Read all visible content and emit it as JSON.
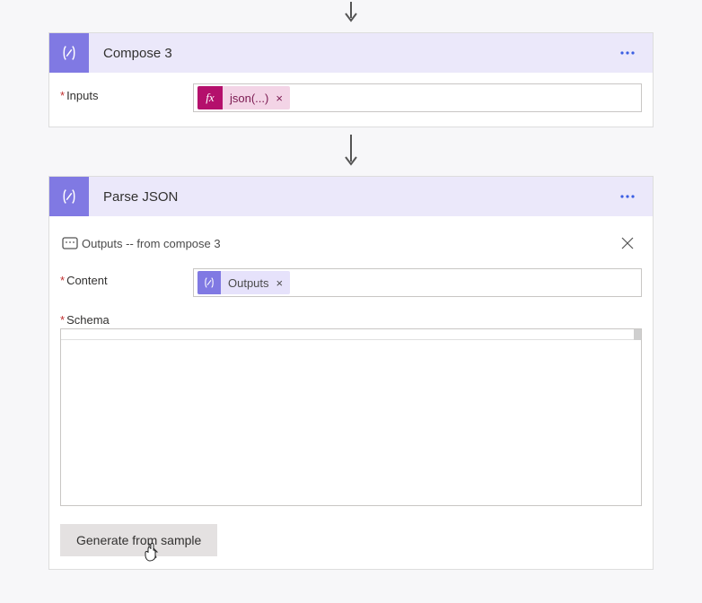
{
  "arrow1": true,
  "compose": {
    "title": "Compose 3",
    "inputs_label": "Inputs",
    "token_fx_icon": "fx",
    "token_fx_label": "json(...)"
  },
  "arrow2": true,
  "parse": {
    "title": "Parse JSON",
    "hint": "Outputs -- from compose 3",
    "content_label": "Content",
    "content_token_label": "Outputs",
    "schema_label": "Schema",
    "generate_btn": "Generate from sample"
  }
}
